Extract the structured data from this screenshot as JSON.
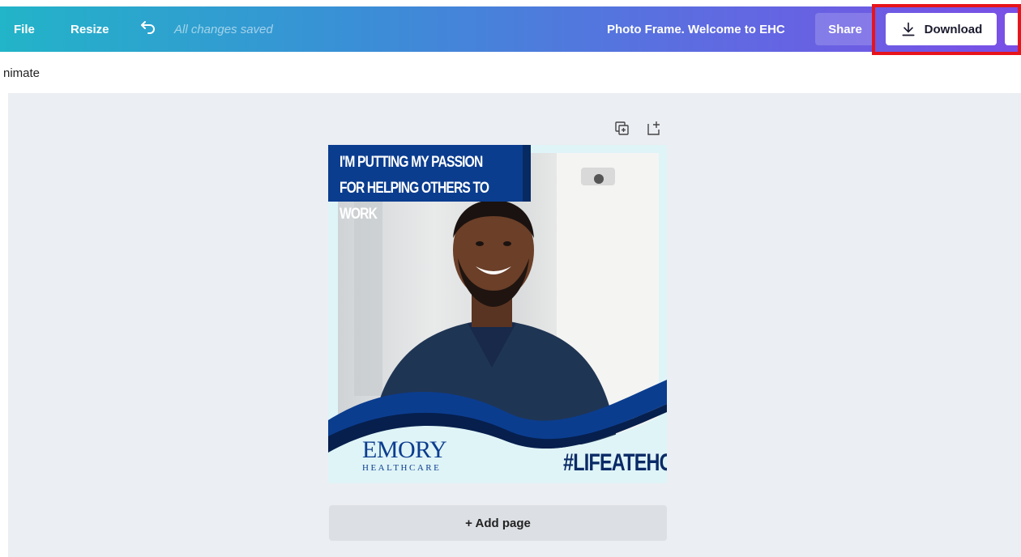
{
  "topbar": {
    "file_label": "File",
    "resize_label": "Resize",
    "save_status": "All changes saved",
    "document_title": "Photo Frame. Welcome to EHC",
    "share_label": "Share",
    "download_label": "Download",
    "undo_icon": "undo-icon",
    "download_icon": "download-icon"
  },
  "toolbar": {
    "animate_label": "nimate"
  },
  "page_actions": {
    "duplicate_icon": "duplicate-page-icon",
    "add_icon": "add-page-icon"
  },
  "design": {
    "banner_text": "I'M PUTTING MY PASSION FOR HELPING OTHERS TO WORK",
    "logo_main": "EMORY",
    "logo_sub": "HEALTHCARE",
    "hashtag": "#LIFEATEHC"
  },
  "add_page_label": "+ Add page",
  "colors": {
    "highlight": "#e8141b",
    "brand_blue": "#0b3d8f"
  }
}
